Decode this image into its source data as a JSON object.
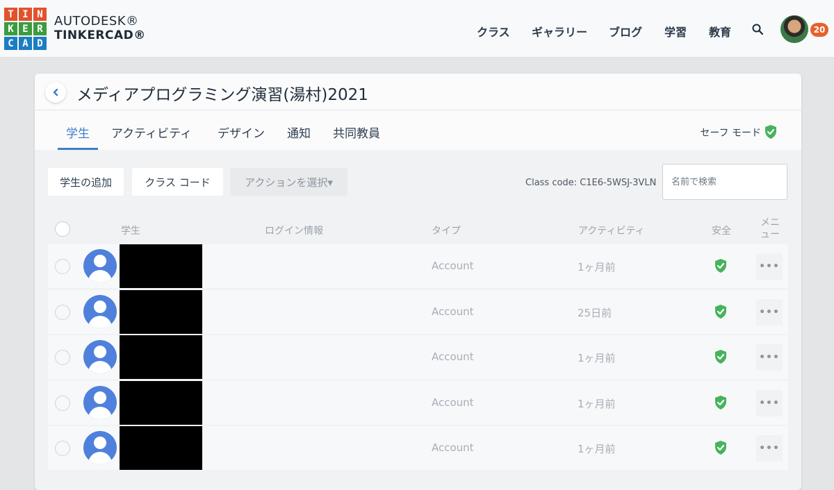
{
  "logo": {
    "letters": [
      "T",
      "I",
      "N",
      "K",
      "E",
      "R",
      "C",
      "A",
      "D"
    ],
    "colors": [
      "#e2512e",
      "#e2512e",
      "#e2512e",
      "#3b9c3f",
      "#3b9c3f",
      "#3b9c3f",
      "#1b7dc2",
      "#1b7dc2",
      "#1b7dc2"
    ]
  },
  "brand": {
    "line1": "AUTODESK®",
    "line2": "TINKERCAD®"
  },
  "nav": {
    "items": [
      "クラス",
      "ギャラリー",
      "ブログ",
      "学習",
      "教育"
    ]
  },
  "user": {
    "notification_count": "20"
  },
  "panel": {
    "title": "メディアプログラミング演習(湯村)2021",
    "tabs": [
      "学生",
      "アクティビティ",
      "デザイン",
      "通知",
      "共同教員"
    ],
    "active_tab": "学生",
    "safe_mode_label": "セーフ モード"
  },
  "toolbar": {
    "add_student": "学生の追加",
    "class_code_button": "クラス コード",
    "action_select": "アクションを選択▾",
    "class_code_text": "Class code: C1E6-5WSJ-3VLN",
    "search_placeholder": "名前で検索"
  },
  "table": {
    "headers": {
      "student": "学生",
      "login": "ログイン情報",
      "type": "タイプ",
      "activity": "アクティビティ",
      "safety": "安全",
      "menu": "メニュー"
    },
    "rows": [
      {
        "type": "Account",
        "activity": "1ヶ月前"
      },
      {
        "type": "Account",
        "activity": "25日前"
      },
      {
        "type": "Account",
        "activity": "1ヶ月前"
      },
      {
        "type": "Account",
        "activity": "1ヶ月前"
      },
      {
        "type": "Account",
        "activity": "1ヶ月前"
      }
    ],
    "row_menu_label": "•••"
  },
  "colors": {
    "accent": "#3d7ec9",
    "safe_green": "#47b35c",
    "badge": "#e8602b"
  }
}
